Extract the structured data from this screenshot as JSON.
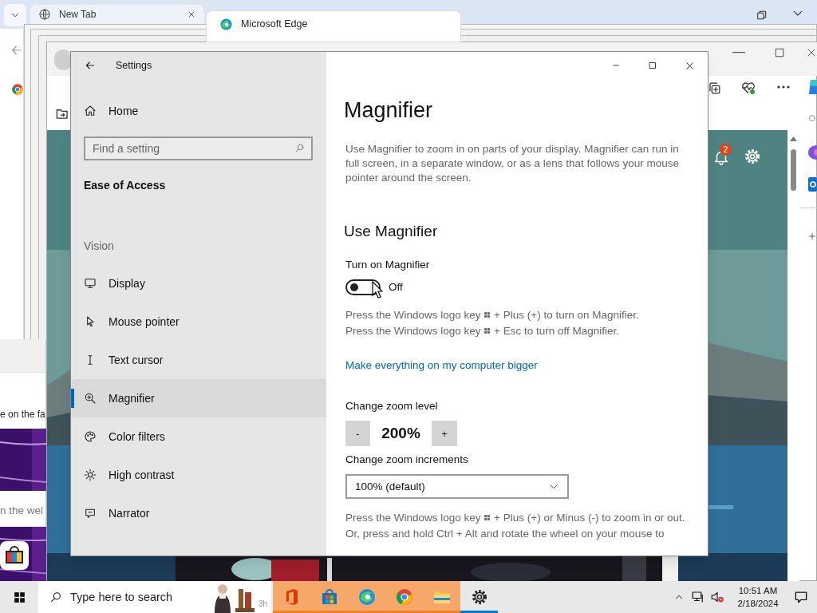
{
  "background": {
    "tabs": [
      {
        "title": "New Tab",
        "selected": false
      },
      {
        "title": "Microsoft Edge",
        "selected": true
      }
    ],
    "snippets": [
      "e on the fa",
      "n the wel"
    ],
    "notification_badge": "2"
  },
  "settings": {
    "title": "Settings",
    "home": "Home",
    "search": {
      "placeholder": "Find a setting"
    },
    "section": "Ease of Access",
    "group": "Vision",
    "nav": [
      {
        "label": "Display",
        "kind": "display",
        "selected": false
      },
      {
        "label": "Mouse pointer",
        "kind": "pointer",
        "selected": false
      },
      {
        "label": "Text cursor",
        "kind": "cursor",
        "selected": false
      },
      {
        "label": "Magnifier",
        "kind": "magnifier",
        "selected": true
      },
      {
        "label": "Color filters",
        "kind": "palette",
        "selected": false
      },
      {
        "label": "High contrast",
        "kind": "sun",
        "selected": false
      },
      {
        "label": "Narrator",
        "kind": "narrator",
        "selected": false
      }
    ],
    "page_title": "Magnifier",
    "description": "Use Magnifier to zoom in on parts of your display. Magnifier can run in full screen, in a separate window, or as a lens that follows your mouse pointer around the screen.",
    "heading": "Use Magnifier",
    "toggle": {
      "label": "Turn on Magnifier",
      "on": false,
      "state_text": "Off"
    },
    "hints": [
      {
        "before": "Press the Windows logo key",
        "after": "+ Plus (+) to turn on Magnifier."
      },
      {
        "before": "Press the Windows logo key",
        "after": "+ Esc to turn off Magnifier."
      }
    ],
    "link": "Make everything on my computer bigger",
    "zoom": {
      "label": "Change zoom level",
      "minus": "-",
      "value": "200%",
      "plus": "+"
    },
    "increments": {
      "label": "Change zoom increments",
      "value": "100% (default)"
    },
    "notes": [
      {
        "before": "Press the Windows logo key",
        "after": "+ Plus (+) or Minus (-) to zoom in or out."
      },
      {
        "before": "Or, press and hold Ctrl + Alt and rotate the wheel on your mouse to"
      }
    ]
  },
  "taskbar": {
    "search": {
      "placeholder": "Type here to search"
    },
    "badge": "3h",
    "apps": [
      {
        "kind": "office",
        "flashing": true
      },
      {
        "kind": "store",
        "flashing": true
      },
      {
        "kind": "edge",
        "flashing": true
      },
      {
        "kind": "chrome",
        "flashing": true
      },
      {
        "kind": "explorer",
        "flashing": true
      },
      {
        "kind": "settings",
        "flashing": false
      }
    ],
    "time": "10:51 AM",
    "date": "2/18/2024"
  }
}
